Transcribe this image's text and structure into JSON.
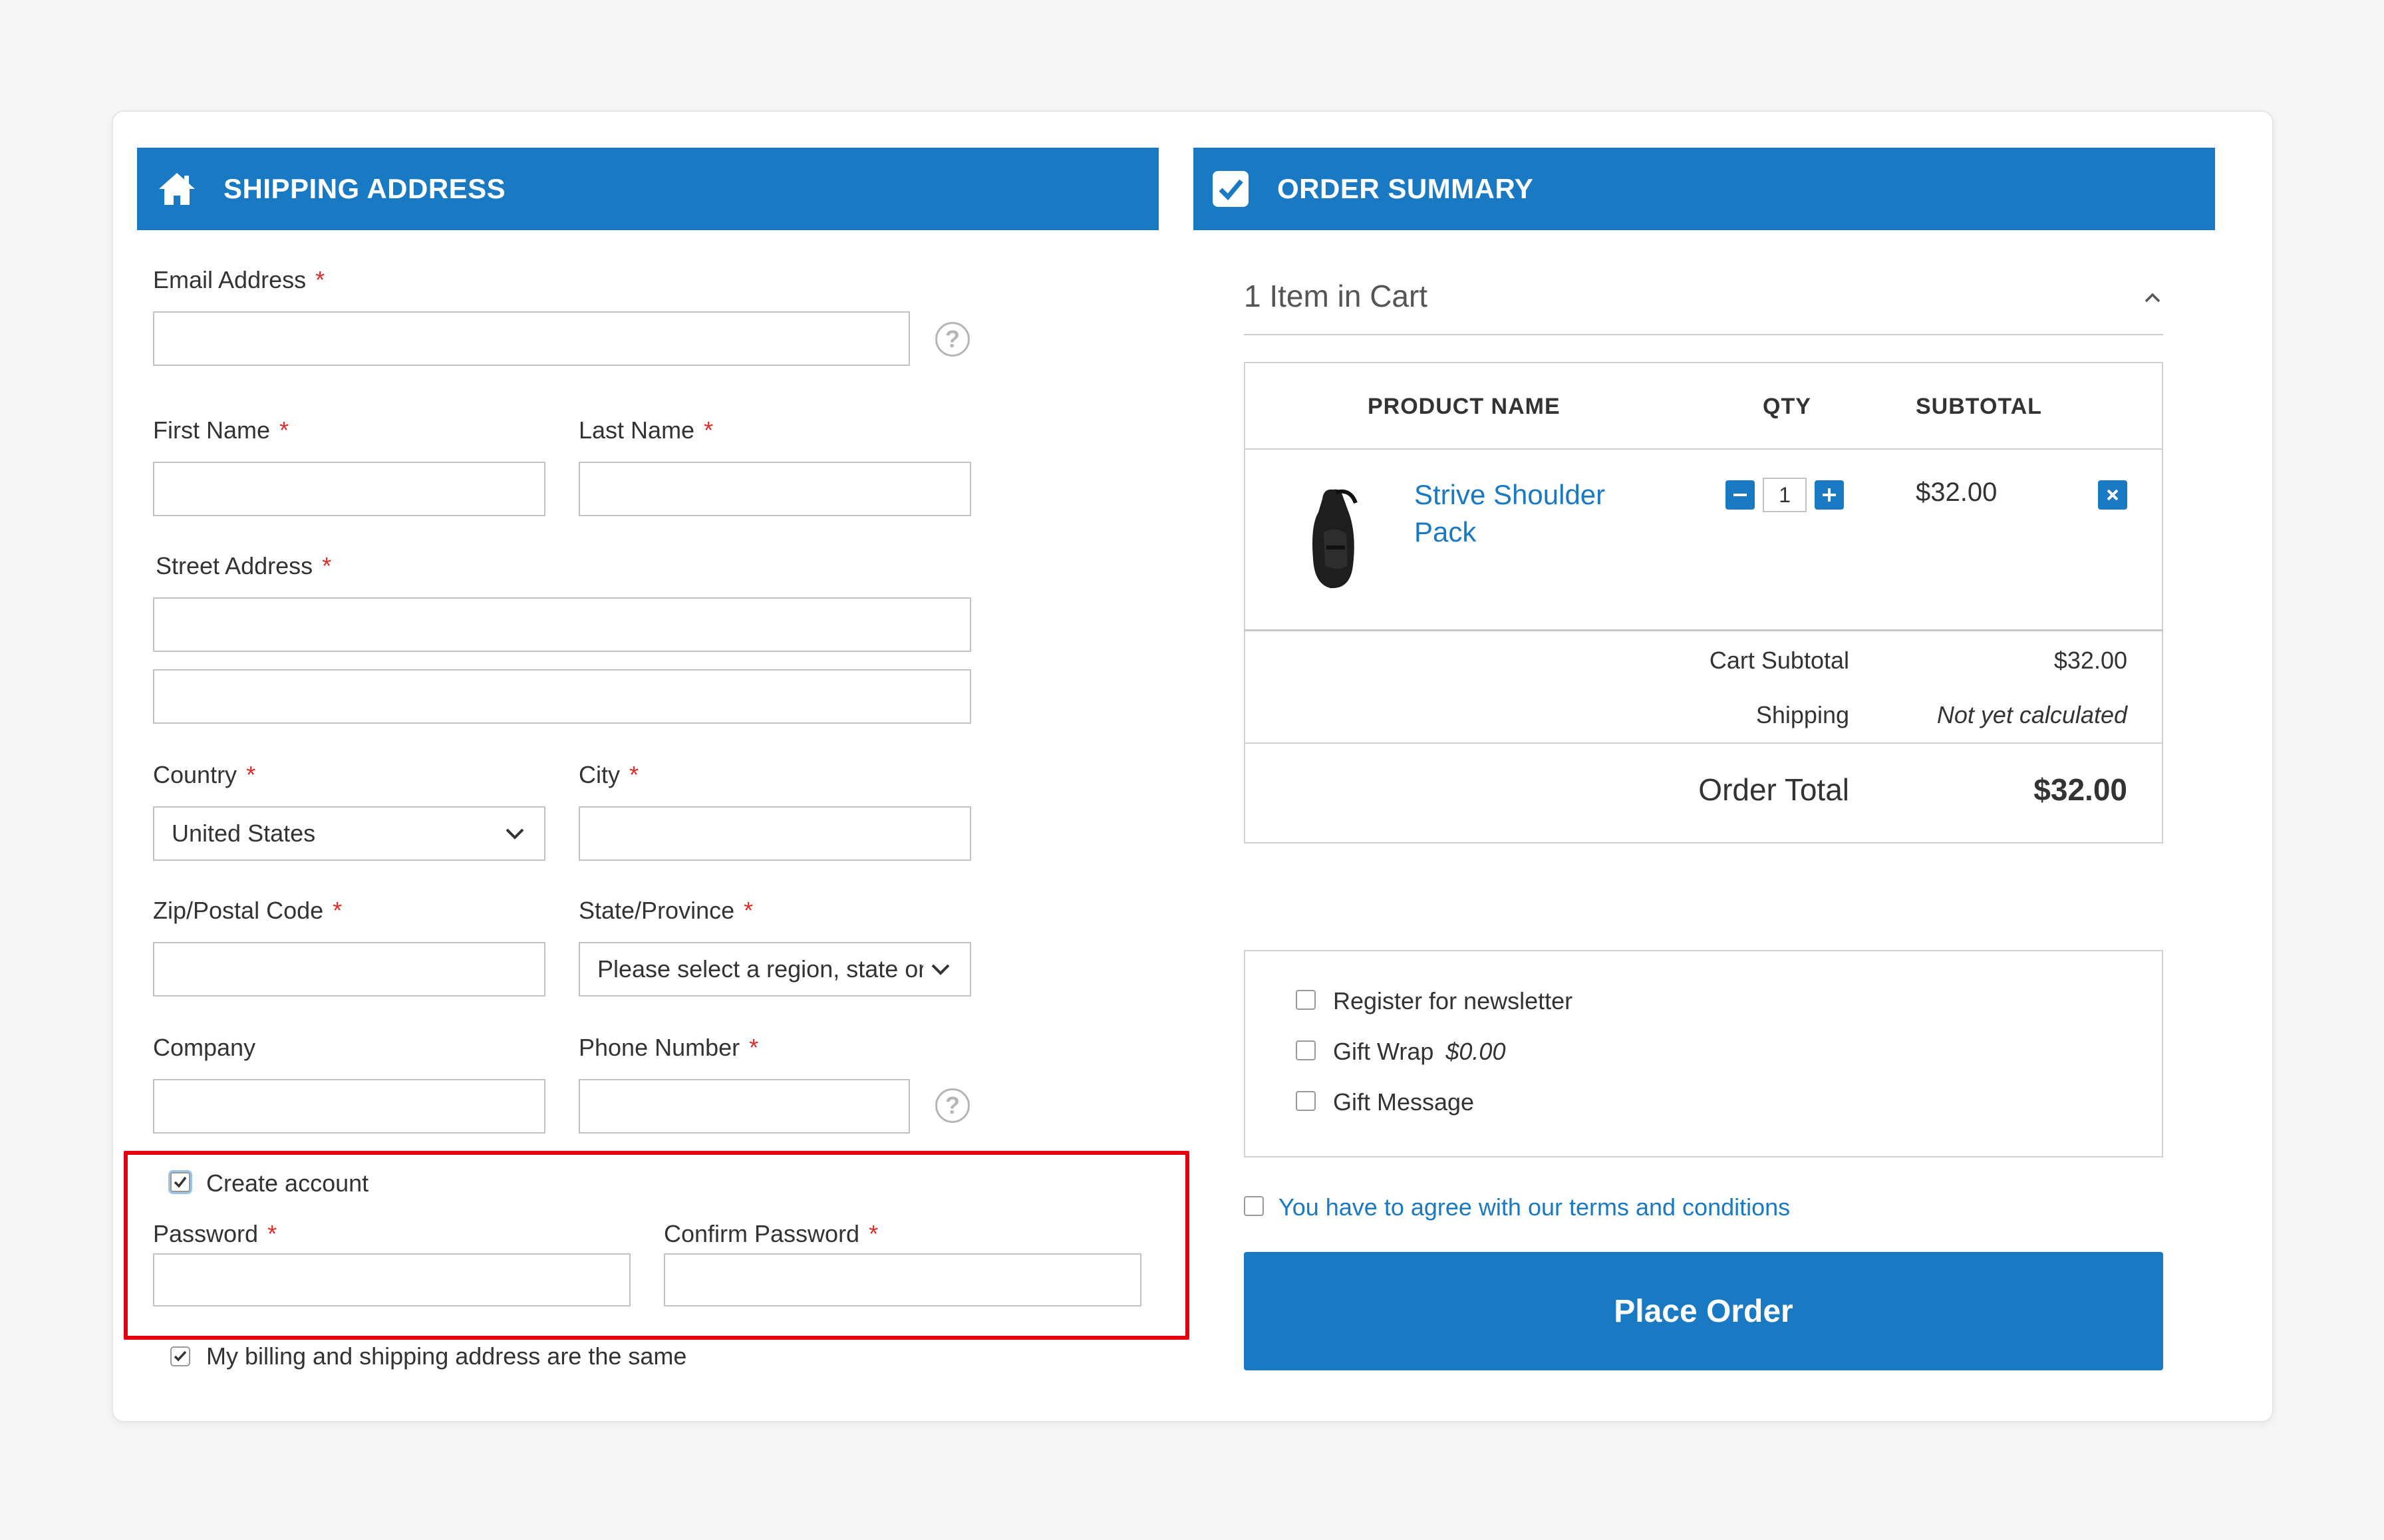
{
  "shipping": {
    "header": "SHIPPING ADDRESS",
    "email_label": "Email Address",
    "first_name_label": "First Name",
    "last_name_label": "Last Name",
    "street_label": "Street Address",
    "country_label": "Country",
    "country_value": "United States",
    "city_label": "City",
    "zip_label": "Zip/Postal Code",
    "state_label": "State/Province",
    "state_value": "Please select a region, state or province.",
    "company_label": "Company",
    "phone_label": "Phone Number",
    "required_mark": "*",
    "help_glyph": "?",
    "create_account_label": "Create account",
    "password_label": "Password",
    "confirm_password_label": "Confirm Password",
    "billing_same_label": "My billing and shipping address are the same"
  },
  "summary": {
    "header": "ORDER SUMMARY",
    "items_in_cart": "1 Item in Cart",
    "col_product": "PRODUCT NAME",
    "col_qty": "QTY",
    "col_subtotal": "SUBTOTAL",
    "items": [
      {
        "name": "Strive Shoulder Pack",
        "qty": "1",
        "subtotal": "$32.00"
      }
    ],
    "cart_subtotal_label": "Cart Subtotal",
    "cart_subtotal_value": "$32.00",
    "shipping_label": "Shipping",
    "shipping_value": "Not yet calculated",
    "order_total_label": "Order Total",
    "order_total_value": "$32.00"
  },
  "options": {
    "newsletter_label": "Register for newsletter",
    "gift_wrap_label": "Gift Wrap",
    "gift_wrap_price": "$0.00",
    "gift_message_label": "Gift Message",
    "terms_label": "You have to agree with our terms and conditions"
  },
  "place_order_label": "Place Order",
  "colors": {
    "accent": "#1979c3",
    "required": "#e02b27",
    "highlight": "#e3000f"
  }
}
